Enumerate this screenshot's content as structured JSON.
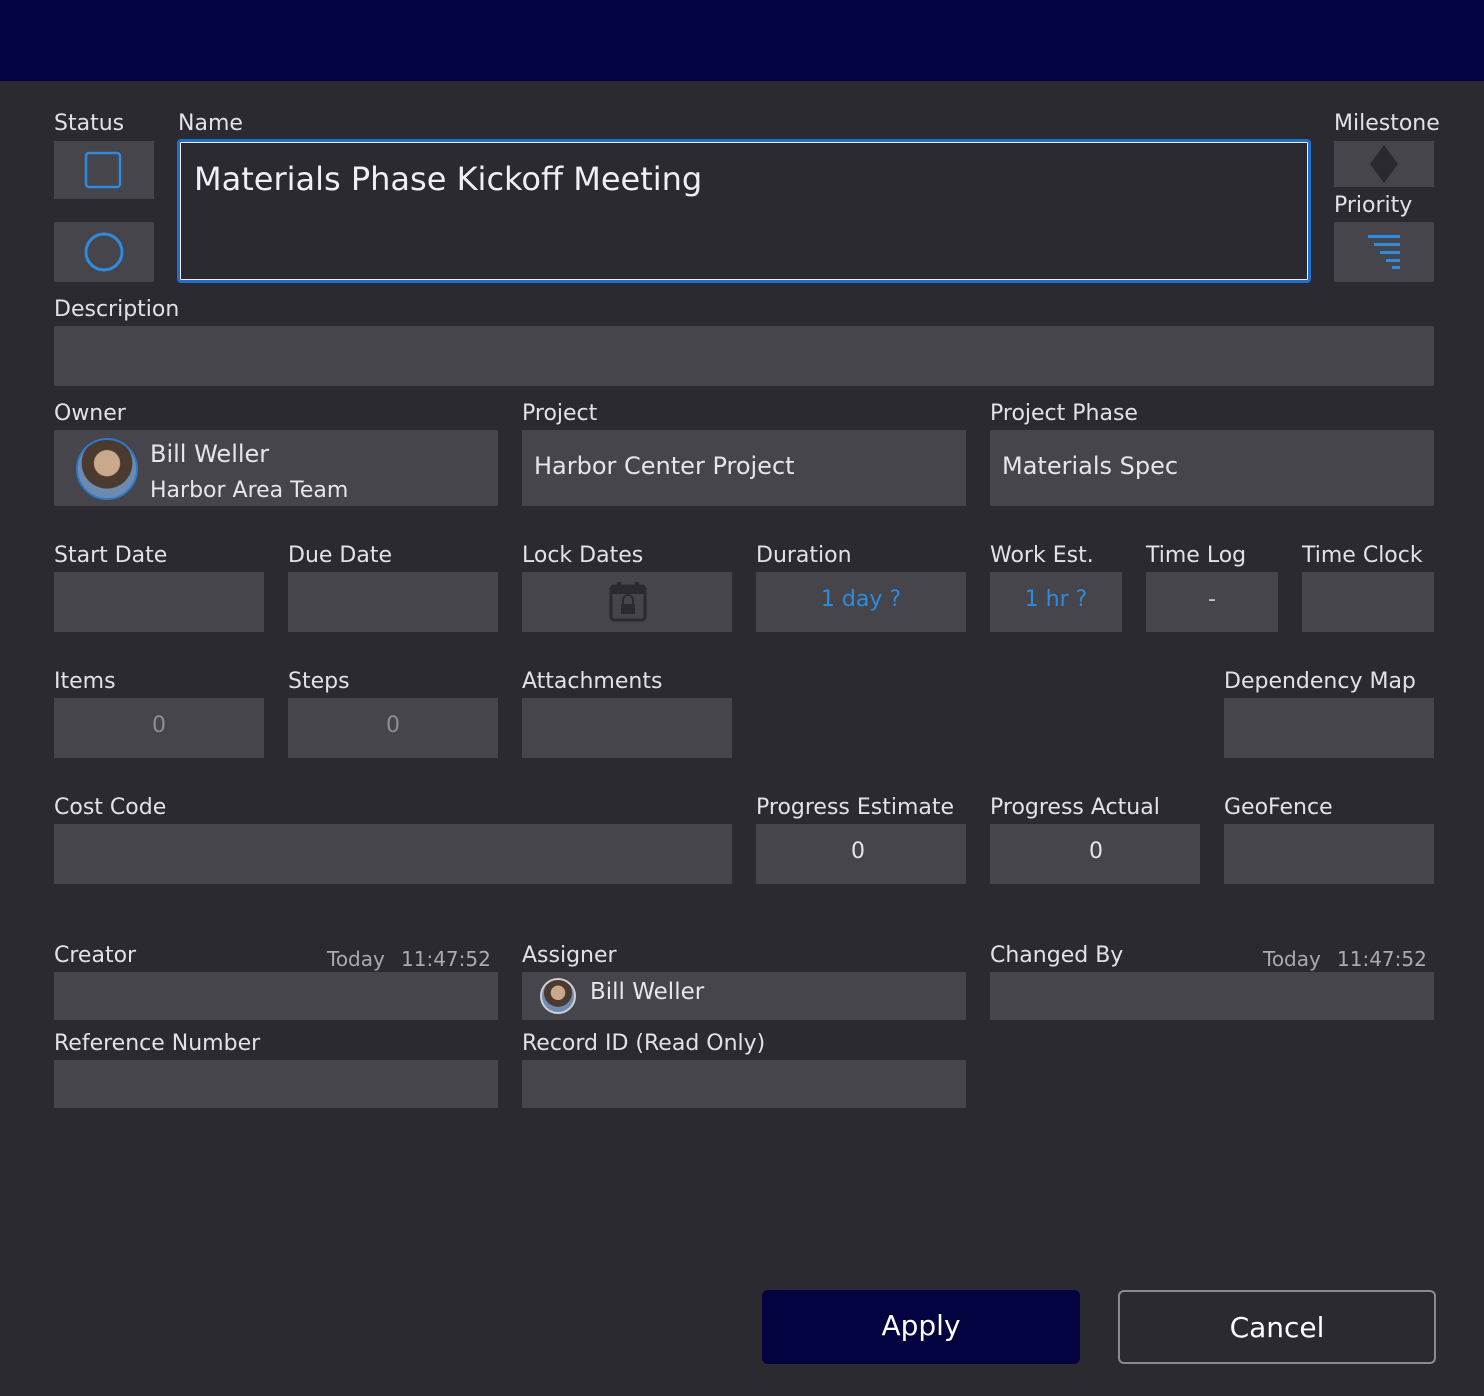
{
  "form": {
    "status_label": "Status",
    "name_label": "Name",
    "name_value": "Materials Phase Kickoff Meeting",
    "milestone_label": "Milestone",
    "priority_label": "Priority",
    "description_label": "Description",
    "owner_label": "Owner",
    "owner_name": "Bill Weller",
    "owner_team": "Harbor Area Team",
    "project_label": "Project",
    "project_value": "Harbor Center Project",
    "project_phase_label": "Project Phase",
    "project_phase_value": "Materials Spec",
    "start_date_label": "Start Date",
    "due_date_label": "Due Date",
    "lock_dates_label": "Lock Dates",
    "duration_label": "Duration",
    "duration_value": "1 day ?",
    "work_est_label": "Work Est.",
    "work_est_value": "1 hr ?",
    "time_log_label": "Time Log",
    "time_log_value": "-",
    "time_clock_label": "Time Clock",
    "items_label": "Items",
    "items_value": "0",
    "steps_label": "Steps",
    "steps_value": "0",
    "attachments_label": "Attachments",
    "dependency_map_label": "Dependency Map",
    "cost_code_label": "Cost Code",
    "progress_estimate_label": "Progress Estimate",
    "progress_estimate_value": "0",
    "progress_actual_label": "Progress Actual",
    "progress_actual_value": "0",
    "geofence_label": "GeoFence",
    "creator_label": "Creator",
    "creator_day": "Today",
    "creator_time": "11:47:52",
    "assigner_label": "Assigner",
    "assigner_name": "Bill Weller",
    "changed_by_label": "Changed By",
    "changed_by_day": "Today",
    "changed_by_time": "11:47:52",
    "reference_number_label": "Reference Number",
    "record_id_label": "Record ID (Read Only)"
  },
  "actions": {
    "apply_label": "Apply",
    "cancel_label": "Cancel"
  },
  "icons": {
    "status_checkbox": "checkbox-icon",
    "status_circle": "circle-icon",
    "milestone": "diamond-icon",
    "priority": "priority-filter-icon",
    "lock_dates": "calendar-lock-icon"
  },
  "colors": {
    "header": "#020340",
    "accent": "#2f8be0",
    "focus_border": "#1e6fd0",
    "field_bg": "#45454b",
    "panel_bg": "#2a2a30"
  }
}
